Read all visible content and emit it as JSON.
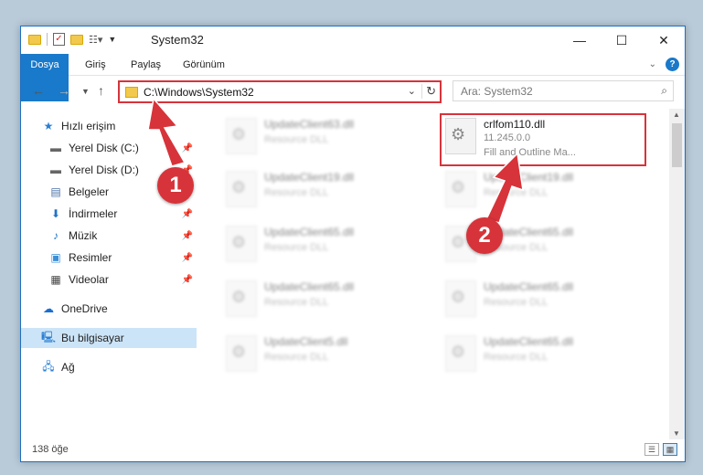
{
  "window": {
    "title": "System32"
  },
  "title_controls": {
    "minimize": "—",
    "maximize": "☐",
    "close": "✕"
  },
  "ribbon": {
    "tabs": [
      "Dosya",
      "Giriş",
      "Paylaş",
      "Görünüm"
    ],
    "help": "?"
  },
  "address": {
    "path": "C:\\Windows\\System32",
    "search_placeholder": "Ara: System32"
  },
  "sidebar": {
    "items": [
      {
        "label": "Hızlı erişim",
        "icon": "star-icon",
        "pinned": false
      },
      {
        "label": "Yerel Disk (C:)",
        "icon": "drive-icon",
        "pinned": true
      },
      {
        "label": "Yerel Disk (D:)",
        "icon": "drive-icon",
        "pinned": true
      },
      {
        "label": "Belgeler",
        "icon": "documents-icon",
        "pinned": true
      },
      {
        "label": "İndirmeler",
        "icon": "download-icon",
        "pinned": true
      },
      {
        "label": "Müzik",
        "icon": "music-icon",
        "pinned": true
      },
      {
        "label": "Resimler",
        "icon": "pictures-icon",
        "pinned": true
      },
      {
        "label": "Videolar",
        "icon": "videos-icon",
        "pinned": true
      },
      {
        "label": "OneDrive",
        "icon": "cloud-icon",
        "pinned": false
      },
      {
        "label": "Bu bilgisayar",
        "icon": "computer-icon",
        "pinned": false,
        "selected": true
      },
      {
        "label": "Ağ",
        "icon": "network-icon",
        "pinned": false
      }
    ]
  },
  "files": {
    "highlighted": {
      "name": "crlfom110.dll",
      "version": "11.245.0.0",
      "description": "Fill and Outline Ma..."
    },
    "blurred": [
      {
        "name": "UpdateClient63.dll",
        "type": "Resource DLL"
      },
      {
        "name": "UpdateClient19.dll",
        "type": "Resource DLL"
      },
      {
        "name": "UpdateClient19.dll",
        "type": "Resource DLL"
      },
      {
        "name": "UpdateClient65.dll",
        "type": "Resource DLL"
      },
      {
        "name": "UpdateClient65.dll",
        "type": "Resource DLL"
      },
      {
        "name": "UpdateClient65.dll",
        "type": "Resource DLL"
      },
      {
        "name": "UpdateClient65.dll",
        "type": "Resource DLL"
      },
      {
        "name": "UpdateClient5.dll",
        "type": "Resource DLL"
      },
      {
        "name": "UpdateClient65.dll",
        "type": "Resource DLL"
      }
    ]
  },
  "status": {
    "count": "138 öğe"
  },
  "annotations": {
    "step1": "1",
    "step2": "2",
    "color": "#d7333a"
  }
}
